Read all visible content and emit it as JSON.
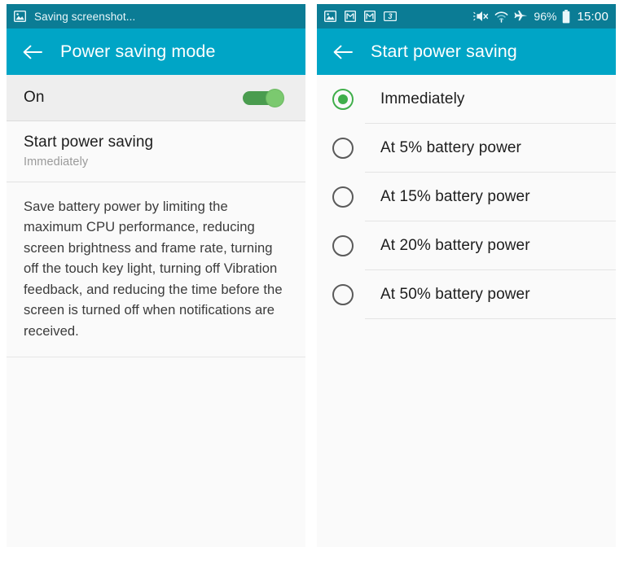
{
  "left_screen": {
    "status_bar": {
      "notification_icon": "image-icon",
      "notification_text": "Saving screenshot..."
    },
    "app_bar": {
      "back_icon": "back-arrow-icon",
      "title": "Power saving mode"
    },
    "toggle_row": {
      "label": "On",
      "state": "on",
      "track_color": "#4a9c4f",
      "knob_color": "#7bc96f"
    },
    "setting_row": {
      "title": "Start power saving",
      "subtitle": "Immediately"
    },
    "description": "Save battery power by limiting the maximum CPU performance, reducing screen brightness and frame rate, turning off the touch key light, turning off Vibration feedback, and reducing the time before the screen is turned off when notifications are received."
  },
  "right_screen": {
    "status_bar": {
      "icons": [
        "image-icon",
        "mail-icon",
        "mail-icon",
        "badge-3-icon"
      ],
      "right_icons": [
        "mute-icon",
        "wifi-icon",
        "airplane-mode-icon"
      ],
      "battery_percent": "96%",
      "battery_icon": "battery-icon",
      "clock": "15:00"
    },
    "app_bar": {
      "back_icon": "back-arrow-icon",
      "title": "Start power saving"
    },
    "options": [
      {
        "label": "Immediately",
        "selected": true
      },
      {
        "label": "At 5% battery power",
        "selected": false
      },
      {
        "label": "At 15% battery power",
        "selected": false
      },
      {
        "label": "At 20% battery power",
        "selected": false
      },
      {
        "label": "At 50% battery power",
        "selected": false
      }
    ]
  },
  "colors": {
    "status_bar": "#0b7c95",
    "app_bar": "#00a5c6",
    "accent_green": "#3fae4a",
    "page_bg": "#fafafa"
  }
}
